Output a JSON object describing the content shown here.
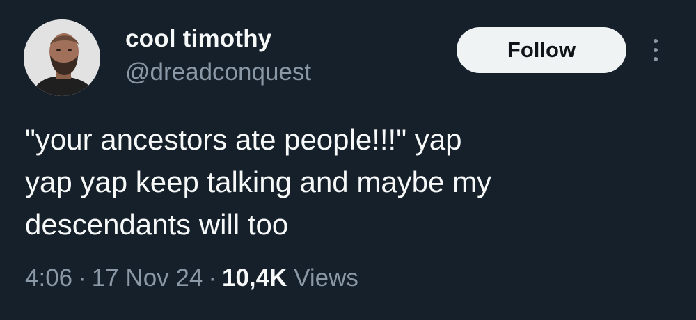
{
  "author": {
    "display_name": "cool timothy",
    "handle": "@dreadconquest"
  },
  "actions": {
    "follow_label": "Follow"
  },
  "tweet": {
    "lines": [
      "\"your ancestors ate people!!!\" yap",
      "yap yap keep talking and maybe my",
      "descendants will too"
    ]
  },
  "meta": {
    "time": "4:06",
    "separator": "·",
    "date": "17 Nov 24",
    "views_count": "10,4K",
    "views_label": "Views"
  },
  "colors": {
    "background": "#15202b",
    "primary_text": "#f7f9f9",
    "secondary_text": "#8b98a5",
    "follow_button": "#eff3f4"
  }
}
